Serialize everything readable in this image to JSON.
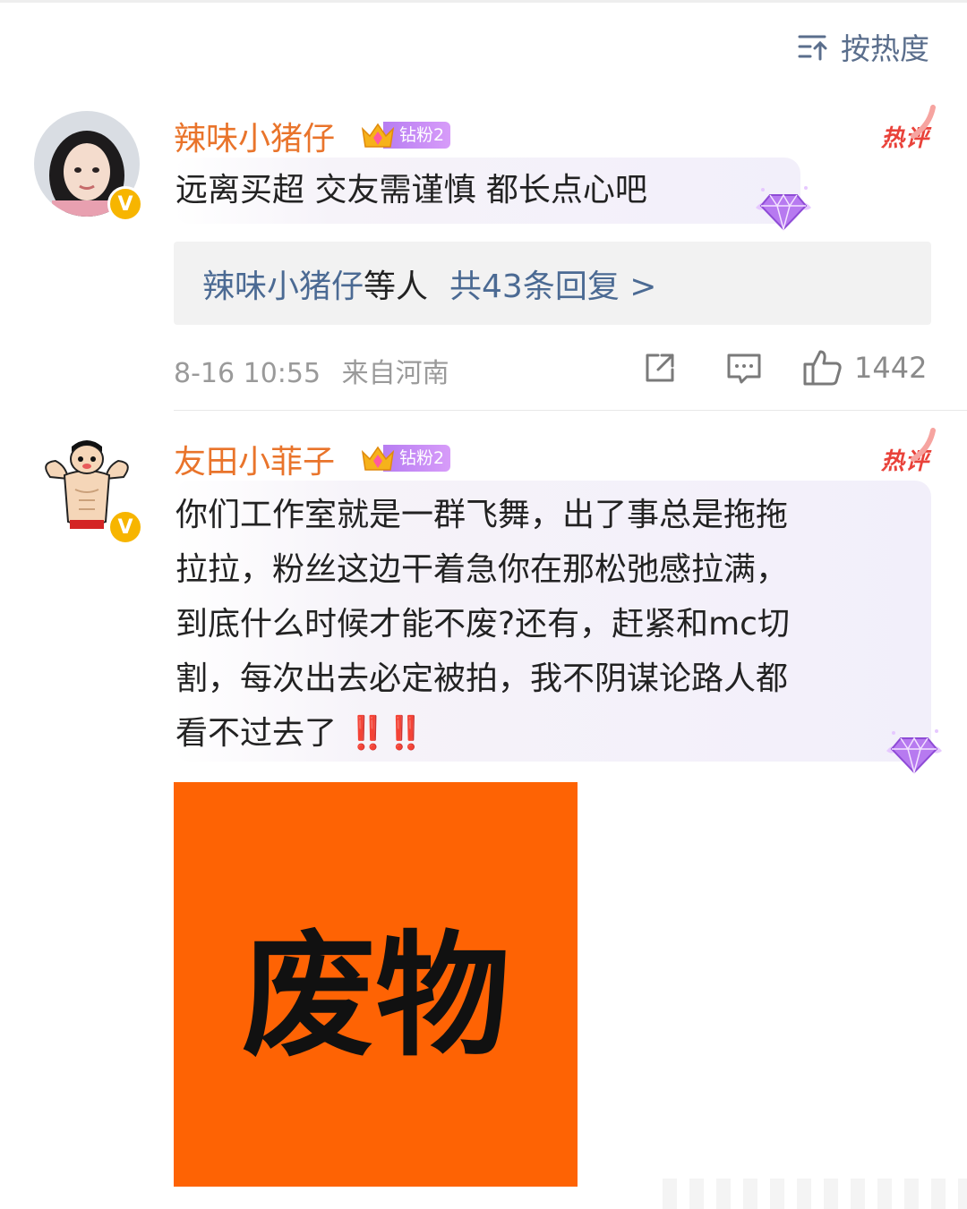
{
  "sort": {
    "label": "按热度"
  },
  "comments": [
    {
      "username": "辣味小猪仔",
      "fan_badge": {
        "level": "钻粉2"
      },
      "hot_tag": "热评",
      "text": "远离买超 交友需谨慎 都长点心吧",
      "replies": {
        "who": "辣味小猪仔",
        "tail": "等人",
        "count_text": "共43条回复 >"
      },
      "time": "8-16 10:55",
      "location": "来自河南",
      "likes": "1442"
    },
    {
      "username": "友田小菲子",
      "fan_badge": {
        "level": "钻粉2"
      },
      "hot_tag": "热评",
      "lines": [
        "你们工作室就是一群飞舞，出了事总是拖拖",
        "拉拉，粉丝这边干着急你在那松弛感拉满，",
        "到底什么时候才能不废?还有，赶紧和mc切",
        "割，每次出去必定被拍，我不阴谋论路人都",
        "看不过去了"
      ],
      "line5_emoji": "‼️‼️",
      "image_text": "废物"
    }
  ],
  "colors": {
    "username": "#e9742b",
    "link": "#4b6a93",
    "hot": "#e9423a",
    "image_bg": "#fe6304"
  }
}
